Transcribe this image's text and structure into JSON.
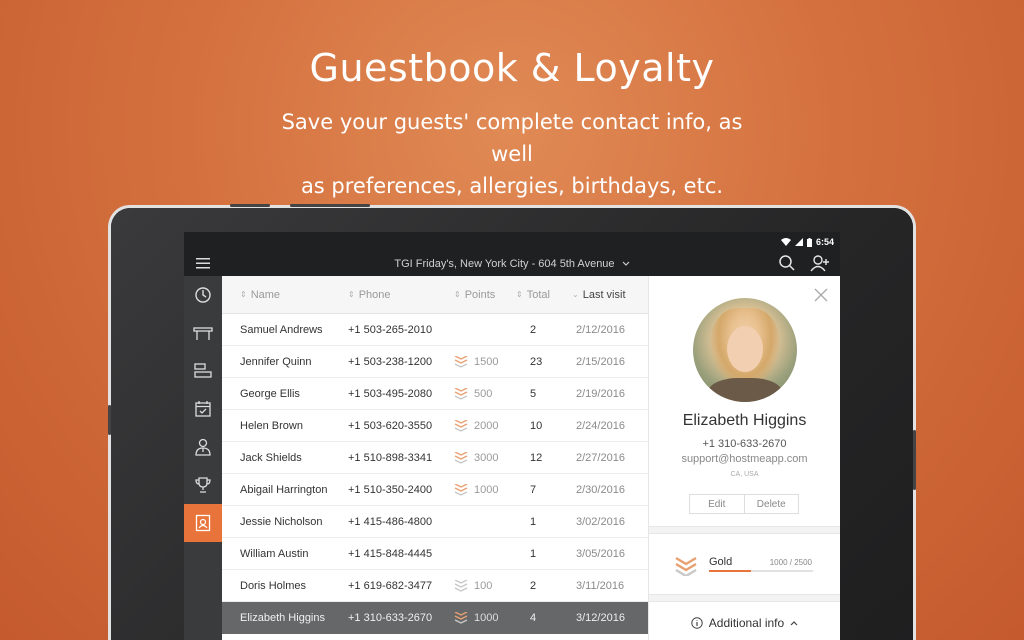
{
  "promo": {
    "title": "Guestbook & Loyalty",
    "subtitle_line1": "Save your guests' complete contact info, as well",
    "subtitle_line2": "as preferences, allergies, birthdays, etc."
  },
  "status": {
    "time": "6:54"
  },
  "topbar": {
    "venue": "TGI Friday's, New York City - 604 5th Avenue"
  },
  "rail": {
    "items": [
      {
        "icon": "clock-icon",
        "active": false
      },
      {
        "icon": "table-icon",
        "active": false
      },
      {
        "icon": "layout-icon",
        "active": false
      },
      {
        "icon": "calendar-check-icon",
        "active": false
      },
      {
        "icon": "waiter-icon",
        "active": false
      },
      {
        "icon": "trophy-icon",
        "active": false
      },
      {
        "icon": "guestbook-icon",
        "active": true
      }
    ]
  },
  "table": {
    "headers": {
      "name": "Name",
      "phone": "Phone",
      "points": "Points",
      "total": "Total",
      "last": "Last visit"
    },
    "rows": [
      {
        "name": "Samuel Andrews",
        "phone": "+1 503-265-2010",
        "points": "",
        "tier": "",
        "total": "2",
        "last": "2/12/2016"
      },
      {
        "name": "Jennifer Quinn",
        "phone": "+1 503-238-1200",
        "points": "1500",
        "tier": "gold",
        "total": "23",
        "last": "2/15/2016"
      },
      {
        "name": "George Ellis",
        "phone": "+1 503-495-2080",
        "points": "500",
        "tier": "gold",
        "total": "5",
        "last": "2/19/2016"
      },
      {
        "name": "Helen Brown",
        "phone": "+1 503-620-3550",
        "points": "2000",
        "tier": "gold",
        "total": "10",
        "last": "2/24/2016"
      },
      {
        "name": "Jack Shields",
        "phone": "+1 510-898-3341",
        "points": "3000",
        "tier": "gold",
        "total": "12",
        "last": "2/27/2016"
      },
      {
        "name": "Abigail Harrington",
        "phone": "+1 510-350-2400",
        "points": "1000",
        "tier": "gold",
        "total": "7",
        "last": "2/30/2016"
      },
      {
        "name": "Jessie Nicholson",
        "phone": "+1 415-486-4800",
        "points": "",
        "tier": "",
        "total": "1",
        "last": "3/02/2016"
      },
      {
        "name": "William Austin",
        "phone": "+1 415-848-4445",
        "points": "",
        "tier": "",
        "total": "1",
        "last": "3/05/2016"
      },
      {
        "name": "Doris Holmes",
        "phone": "+1 619-682-3477",
        "points": "100",
        "tier": "silver",
        "total": "2",
        "last": "3/11/2016"
      },
      {
        "name": "Elizabeth Higgins",
        "phone": "+1 310-633-2670",
        "points": "1000",
        "tier": "gold",
        "total": "4",
        "last": "3/12/2016"
      }
    ]
  },
  "detail": {
    "name": "Elizabeth Higgins",
    "phone": "+1 310-633-2670",
    "email": "support@hostmeapp.com",
    "location": "CA, USA",
    "edit_label": "Edit",
    "delete_label": "Delete",
    "tier": "Gold",
    "points_text": "1000 / 2500",
    "progress": 0.4,
    "additional_label": "Additional info"
  },
  "colors": {
    "accent": "#e8743b",
    "gold": "#e8a070",
    "silver": "#c8c8c8"
  }
}
